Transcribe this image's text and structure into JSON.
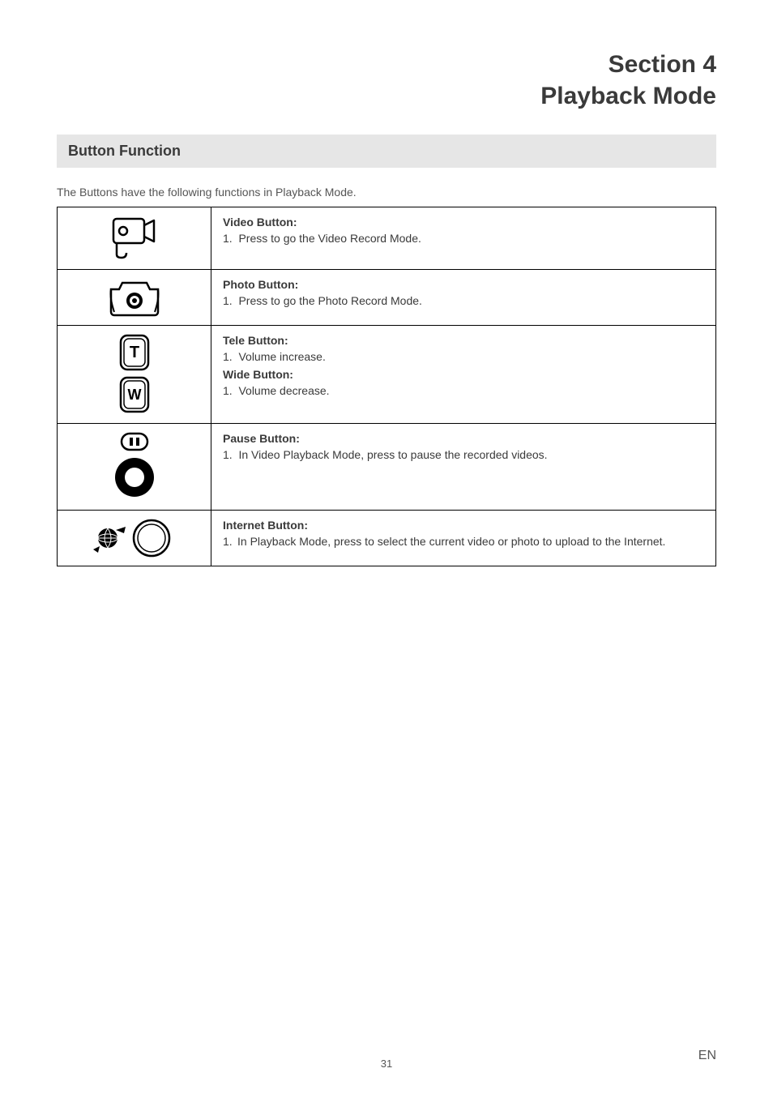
{
  "header": {
    "section_line": "Section 4",
    "title_line": "Playback Mode"
  },
  "subhead": "Button Function",
  "intro": "The Buttons have the following functions in Playback Mode.",
  "rows": [
    {
      "icon": "video-camera-icon",
      "blocks": [
        {
          "heading": "Video Button:",
          "item_no": "1.",
          "item_text": "Press to go the Video Record Mode."
        }
      ]
    },
    {
      "icon": "photo-camera-icon",
      "blocks": [
        {
          "heading": "Photo Button:",
          "item_no": "1.",
          "item_text": "Press to go the Photo Record Mode."
        }
      ]
    },
    {
      "icon": "tele-wide-icon",
      "blocks": [
        {
          "heading": "Tele Button:",
          "item_no": "1.",
          "item_text": "Volume increase."
        },
        {
          "heading": "Wide Button:",
          "item_no": "1.",
          "item_text": "Volume decrease."
        }
      ]
    },
    {
      "icon": "pause-record-icon",
      "blocks": [
        {
          "heading": "Pause Button:",
          "item_no": "1.",
          "item_text": "In Video Playback Mode, press to pause the recorded videos."
        }
      ]
    },
    {
      "icon": "internet-icon",
      "blocks": [
        {
          "heading": "Internet Button:",
          "item_no": "1.",
          "item_text": "In Playback Mode, press to select the current video or photo to upload to the Internet."
        }
      ]
    }
  ],
  "footer": {
    "page_no": "31",
    "lang": "EN"
  }
}
